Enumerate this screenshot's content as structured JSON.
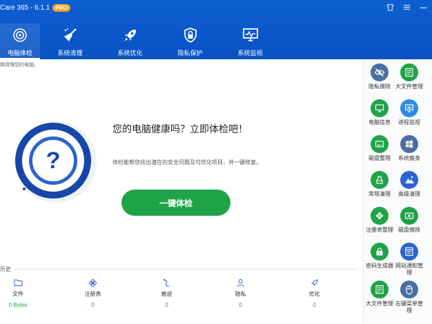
{
  "window": {
    "title": "Care 365 - 6.1.1",
    "badge": "PRO"
  },
  "nav": [
    {
      "label": "电脑体检",
      "icon": "target-icon"
    },
    {
      "label": "系统清理",
      "icon": "broom-icon"
    },
    {
      "label": "系统优化",
      "icon": "rocket-icon"
    },
    {
      "label": "隐私保护",
      "icon": "lock-shield-icon"
    },
    {
      "label": "系统监视",
      "icon": "monitor-icon"
    }
  ],
  "main": {
    "hint": "期清理您的电脑。",
    "headline": "您的电脑健康吗？立即体检吧！",
    "subtext": "体检能帮您找出潜在的安全问题及可优化项目，并一键修复。",
    "check_button": "一键体检",
    "history_label": "历史",
    "stats": [
      {
        "label": "文件",
        "value": "0 Bytes",
        "icon": "folder-icon"
      },
      {
        "label": "注册表",
        "value": "0",
        "icon": "registry-icon"
      },
      {
        "label": "痕迹",
        "value": "0",
        "icon": "trace-icon"
      },
      {
        "label": "隐私",
        "value": "0",
        "icon": "user-icon"
      },
      {
        "label": "优化",
        "value": "0",
        "icon": "rocket-icon"
      }
    ]
  },
  "tools": [
    {
      "label": "隐私擦除",
      "icon": "eye-off-icon",
      "color": "#4a6fa5"
    },
    {
      "label": "大文件管理",
      "icon": "file-list-icon",
      "color": "#1fa347"
    },
    {
      "label": "电脑信息",
      "icon": "pc-info-icon",
      "color": "#1fa347"
    },
    {
      "label": "进程监视",
      "icon": "monitor-wave-icon",
      "color": "#2b8be0"
    },
    {
      "label": "磁盘整理",
      "icon": "disk-icon",
      "color": "#1fa347"
    },
    {
      "label": "系统瘦身",
      "icon": "windows-icon",
      "color": "#4a6fa5"
    },
    {
      "label": "常规清理",
      "icon": "clean-icon",
      "color": "#1fa347"
    },
    {
      "label": "高级清理",
      "icon": "mountain-icon",
      "color": "#2b63d1"
    },
    {
      "label": "注册表整理",
      "icon": "registry-icon",
      "color": "#1fa347"
    },
    {
      "label": "磁盘擦除",
      "icon": "disk-erase-icon",
      "color": "#1fa347"
    },
    {
      "label": "密码生成器",
      "icon": "password-icon",
      "color": "#1fa347"
    },
    {
      "label": "网站通知管理",
      "icon": "notification-icon",
      "color": "#2b63d1"
    },
    {
      "label": "大文件管理",
      "icon": "file-list-icon",
      "color": "#1fa347"
    },
    {
      "label": "右键菜单管理",
      "icon": "mouse-icon",
      "color": "#4a6fa5"
    }
  ]
}
